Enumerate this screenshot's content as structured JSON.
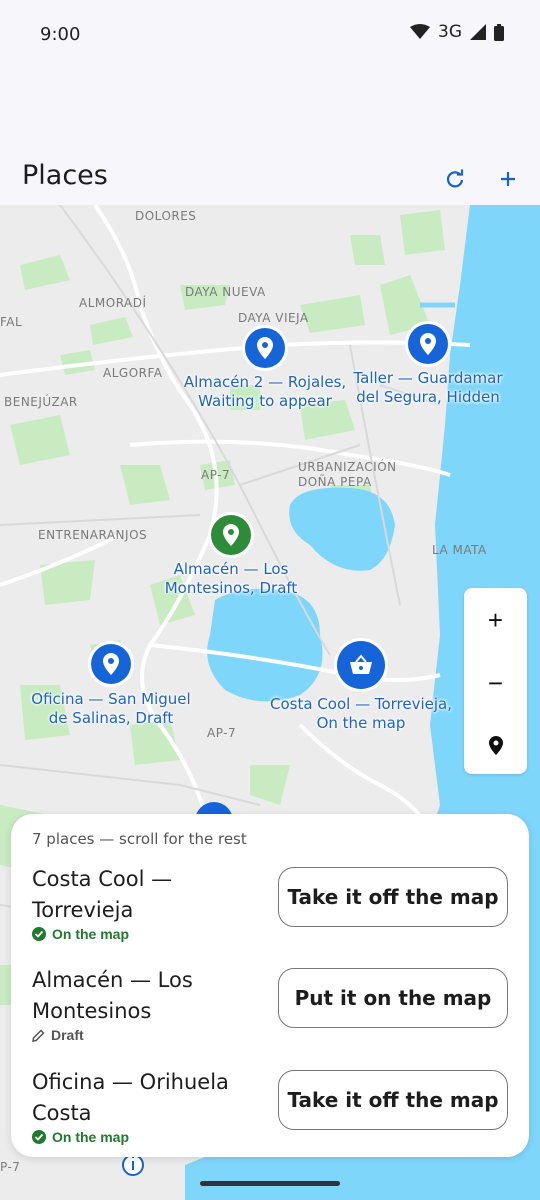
{
  "status_bar": {
    "time": "9:00",
    "network": "3G"
  },
  "app_bar": {
    "title": "Places",
    "refresh_icon": "refresh-icon",
    "add_icon": "add-icon"
  },
  "map": {
    "area_labels": [
      "DOLORES",
      "ALMORADÍ",
      "DAYA NUEVA",
      "DAYA VIEJA",
      "FAL",
      "ALGORFA",
      "BENEJÚZAR",
      "AP-7",
      "URBANIZACIÓN",
      "DOÑA PEPA",
      "ENTRENARANJOS",
      "LA MATA",
      "AP-7",
      "P-7"
    ],
    "places": [
      {
        "label_line1": "Almacén 2 — Rojales,",
        "label_line2": "Waiting to appear",
        "color": "#1565d8",
        "icon": "pin-icon"
      },
      {
        "label_line1": "Taller — Guardamar",
        "label_line2": "del Segura, Hidden",
        "color": "#1565d8",
        "icon": "pin-icon"
      },
      {
        "label_line1": "Almacén — Los",
        "label_line2": "Montesinos, Draft",
        "color": "#2e8b3a",
        "icon": "pin-icon"
      },
      {
        "label_line1": "Oficina — San Miguel",
        "label_line2": "de Salinas, Draft",
        "color": "#1565d8",
        "icon": "pin-icon"
      },
      {
        "label_line1": "Costa Cool — Torrevieja,",
        "label_line2": "On the map",
        "color": "#1565d8",
        "icon": "shopping-basket-icon"
      }
    ],
    "zoom_in": "+",
    "zoom_out": "−",
    "colors": {
      "water": "#7fd6fb",
      "land": "#ececec",
      "green": "#c8ebc2",
      "road": "#ffffff"
    }
  },
  "sheet": {
    "hint": "7 places — scroll for the rest",
    "rows": [
      {
        "name_line1": "Costa Cool —",
        "name_line2": "Torrevieja",
        "status": "On the map",
        "status_color": "#1e7a2e",
        "status_icon": "check-circle-icon",
        "button": "Take it off the map"
      },
      {
        "name_line1": "Almacén — Los",
        "name_line2": "Montesinos",
        "status": "Draft",
        "status_color": "#555555",
        "status_icon": "pencil-icon",
        "button": "Put it on the map"
      },
      {
        "name_line1": "Oficina — Orihuela",
        "name_line2": "Costa",
        "status": "On the map",
        "status_color": "#1e7a2e",
        "status_icon": "check-circle-icon",
        "button": "Take it off the map"
      }
    ]
  }
}
